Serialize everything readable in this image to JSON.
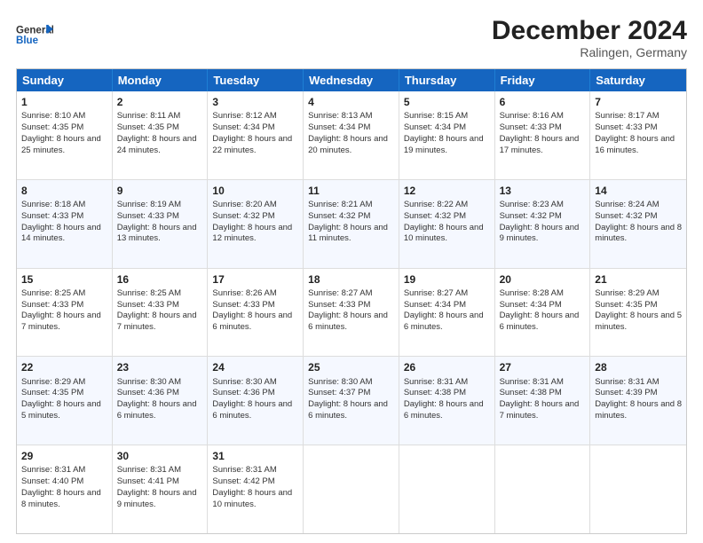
{
  "header": {
    "logo_general": "General",
    "logo_blue": "Blue",
    "month_title": "December 2024",
    "location": "Ralingen, Germany"
  },
  "weekdays": [
    "Sunday",
    "Monday",
    "Tuesday",
    "Wednesday",
    "Thursday",
    "Friday",
    "Saturday"
  ],
  "rows": [
    [
      {
        "day": "1",
        "sunrise": "8:10 AM",
        "sunset": "4:35 PM",
        "daylight": "8 hours and 25 minutes."
      },
      {
        "day": "2",
        "sunrise": "8:11 AM",
        "sunset": "4:35 PM",
        "daylight": "8 hours and 24 minutes."
      },
      {
        "day": "3",
        "sunrise": "8:12 AM",
        "sunset": "4:34 PM",
        "daylight": "8 hours and 22 minutes."
      },
      {
        "day": "4",
        "sunrise": "8:13 AM",
        "sunset": "4:34 PM",
        "daylight": "8 hours and 20 minutes."
      },
      {
        "day": "5",
        "sunrise": "8:15 AM",
        "sunset": "4:34 PM",
        "daylight": "8 hours and 19 minutes."
      },
      {
        "day": "6",
        "sunrise": "8:16 AM",
        "sunset": "4:33 PM",
        "daylight": "8 hours and 17 minutes."
      },
      {
        "day": "7",
        "sunrise": "8:17 AM",
        "sunset": "4:33 PM",
        "daylight": "8 hours and 16 minutes."
      }
    ],
    [
      {
        "day": "8",
        "sunrise": "8:18 AM",
        "sunset": "4:33 PM",
        "daylight": "8 hours and 14 minutes."
      },
      {
        "day": "9",
        "sunrise": "8:19 AM",
        "sunset": "4:33 PM",
        "daylight": "8 hours and 13 minutes."
      },
      {
        "day": "10",
        "sunrise": "8:20 AM",
        "sunset": "4:32 PM",
        "daylight": "8 hours and 12 minutes."
      },
      {
        "day": "11",
        "sunrise": "8:21 AM",
        "sunset": "4:32 PM",
        "daylight": "8 hours and 11 minutes."
      },
      {
        "day": "12",
        "sunrise": "8:22 AM",
        "sunset": "4:32 PM",
        "daylight": "8 hours and 10 minutes."
      },
      {
        "day": "13",
        "sunrise": "8:23 AM",
        "sunset": "4:32 PM",
        "daylight": "8 hours and 9 minutes."
      },
      {
        "day": "14",
        "sunrise": "8:24 AM",
        "sunset": "4:32 PM",
        "daylight": "8 hours and 8 minutes."
      }
    ],
    [
      {
        "day": "15",
        "sunrise": "8:25 AM",
        "sunset": "4:33 PM",
        "daylight": "8 hours and 7 minutes."
      },
      {
        "day": "16",
        "sunrise": "8:25 AM",
        "sunset": "4:33 PM",
        "daylight": "8 hours and 7 minutes."
      },
      {
        "day": "17",
        "sunrise": "8:26 AM",
        "sunset": "4:33 PM",
        "daylight": "8 hours and 6 minutes."
      },
      {
        "day": "18",
        "sunrise": "8:27 AM",
        "sunset": "4:33 PM",
        "daylight": "8 hours and 6 minutes."
      },
      {
        "day": "19",
        "sunrise": "8:27 AM",
        "sunset": "4:34 PM",
        "daylight": "8 hours and 6 minutes."
      },
      {
        "day": "20",
        "sunrise": "8:28 AM",
        "sunset": "4:34 PM",
        "daylight": "8 hours and 6 minutes."
      },
      {
        "day": "21",
        "sunrise": "8:29 AM",
        "sunset": "4:35 PM",
        "daylight": "8 hours and 5 minutes."
      }
    ],
    [
      {
        "day": "22",
        "sunrise": "8:29 AM",
        "sunset": "4:35 PM",
        "daylight": "8 hours and 5 minutes."
      },
      {
        "day": "23",
        "sunrise": "8:30 AM",
        "sunset": "4:36 PM",
        "daylight": "8 hours and 6 minutes."
      },
      {
        "day": "24",
        "sunrise": "8:30 AM",
        "sunset": "4:36 PM",
        "daylight": "8 hours and 6 minutes."
      },
      {
        "day": "25",
        "sunrise": "8:30 AM",
        "sunset": "4:37 PM",
        "daylight": "8 hours and 6 minutes."
      },
      {
        "day": "26",
        "sunrise": "8:31 AM",
        "sunset": "4:38 PM",
        "daylight": "8 hours and 6 minutes."
      },
      {
        "day": "27",
        "sunrise": "8:31 AM",
        "sunset": "4:38 PM",
        "daylight": "8 hours and 7 minutes."
      },
      {
        "day": "28",
        "sunrise": "8:31 AM",
        "sunset": "4:39 PM",
        "daylight": "8 hours and 8 minutes."
      }
    ],
    [
      {
        "day": "29",
        "sunrise": "8:31 AM",
        "sunset": "4:40 PM",
        "daylight": "8 hours and 8 minutes."
      },
      {
        "day": "30",
        "sunrise": "8:31 AM",
        "sunset": "4:41 PM",
        "daylight": "8 hours and 9 minutes."
      },
      {
        "day": "31",
        "sunrise": "8:31 AM",
        "sunset": "4:42 PM",
        "daylight": "8 hours and 10 minutes."
      },
      null,
      null,
      null,
      null
    ]
  ],
  "labels": {
    "sunrise_prefix": "Sunrise: ",
    "sunset_prefix": "Sunset: ",
    "daylight_prefix": "Daylight: "
  }
}
